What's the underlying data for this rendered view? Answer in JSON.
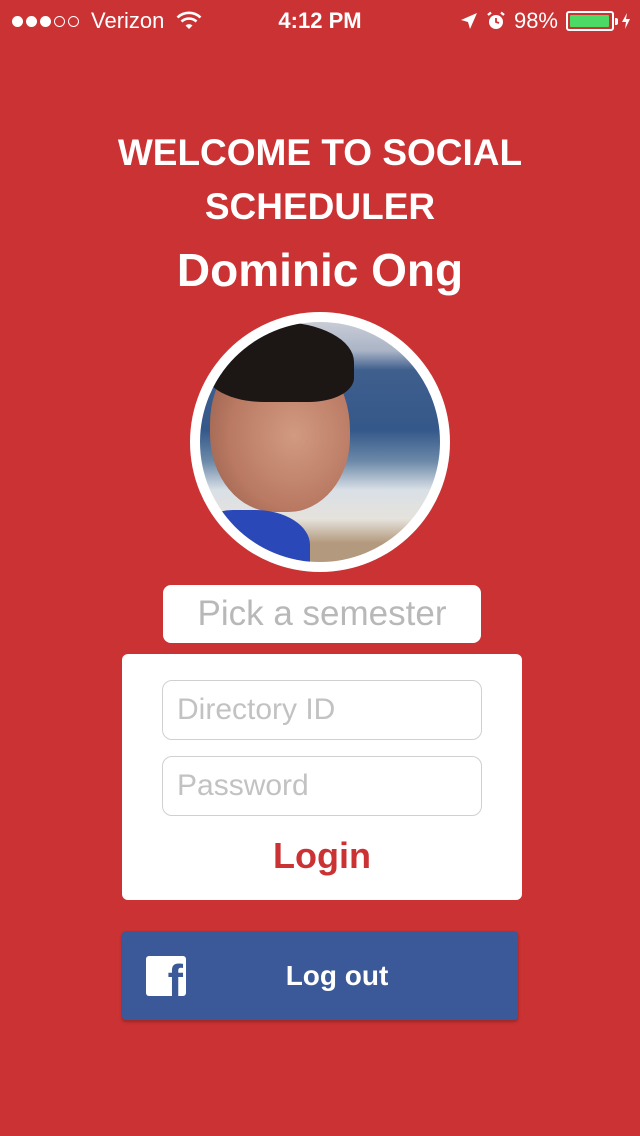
{
  "status_bar": {
    "carrier": "Verizon",
    "time": "4:12 PM",
    "battery": "98%",
    "battery_level": 0.98,
    "signal_bars_filled": 3,
    "signal_bars_total": 5,
    "icons": [
      "wifi-icon",
      "location-arrow-icon",
      "alarm-icon",
      "battery-icon",
      "charging-bolt-icon"
    ]
  },
  "header": {
    "welcome": "WELCOME TO SOCIAL SCHEDULER",
    "user_name": "Dominic Ong"
  },
  "semester_picker": {
    "placeholder": "Pick a semester"
  },
  "login": {
    "directory_id_placeholder": "Directory ID",
    "password_placeholder": "Password",
    "login_label": "Login"
  },
  "facebook": {
    "logout_label": "Log out",
    "icon": "facebook-f-icon"
  },
  "colors": {
    "background": "#cb3234",
    "accent": "#cb3234",
    "facebook": "#3b5998",
    "battery": "#4cd964"
  }
}
